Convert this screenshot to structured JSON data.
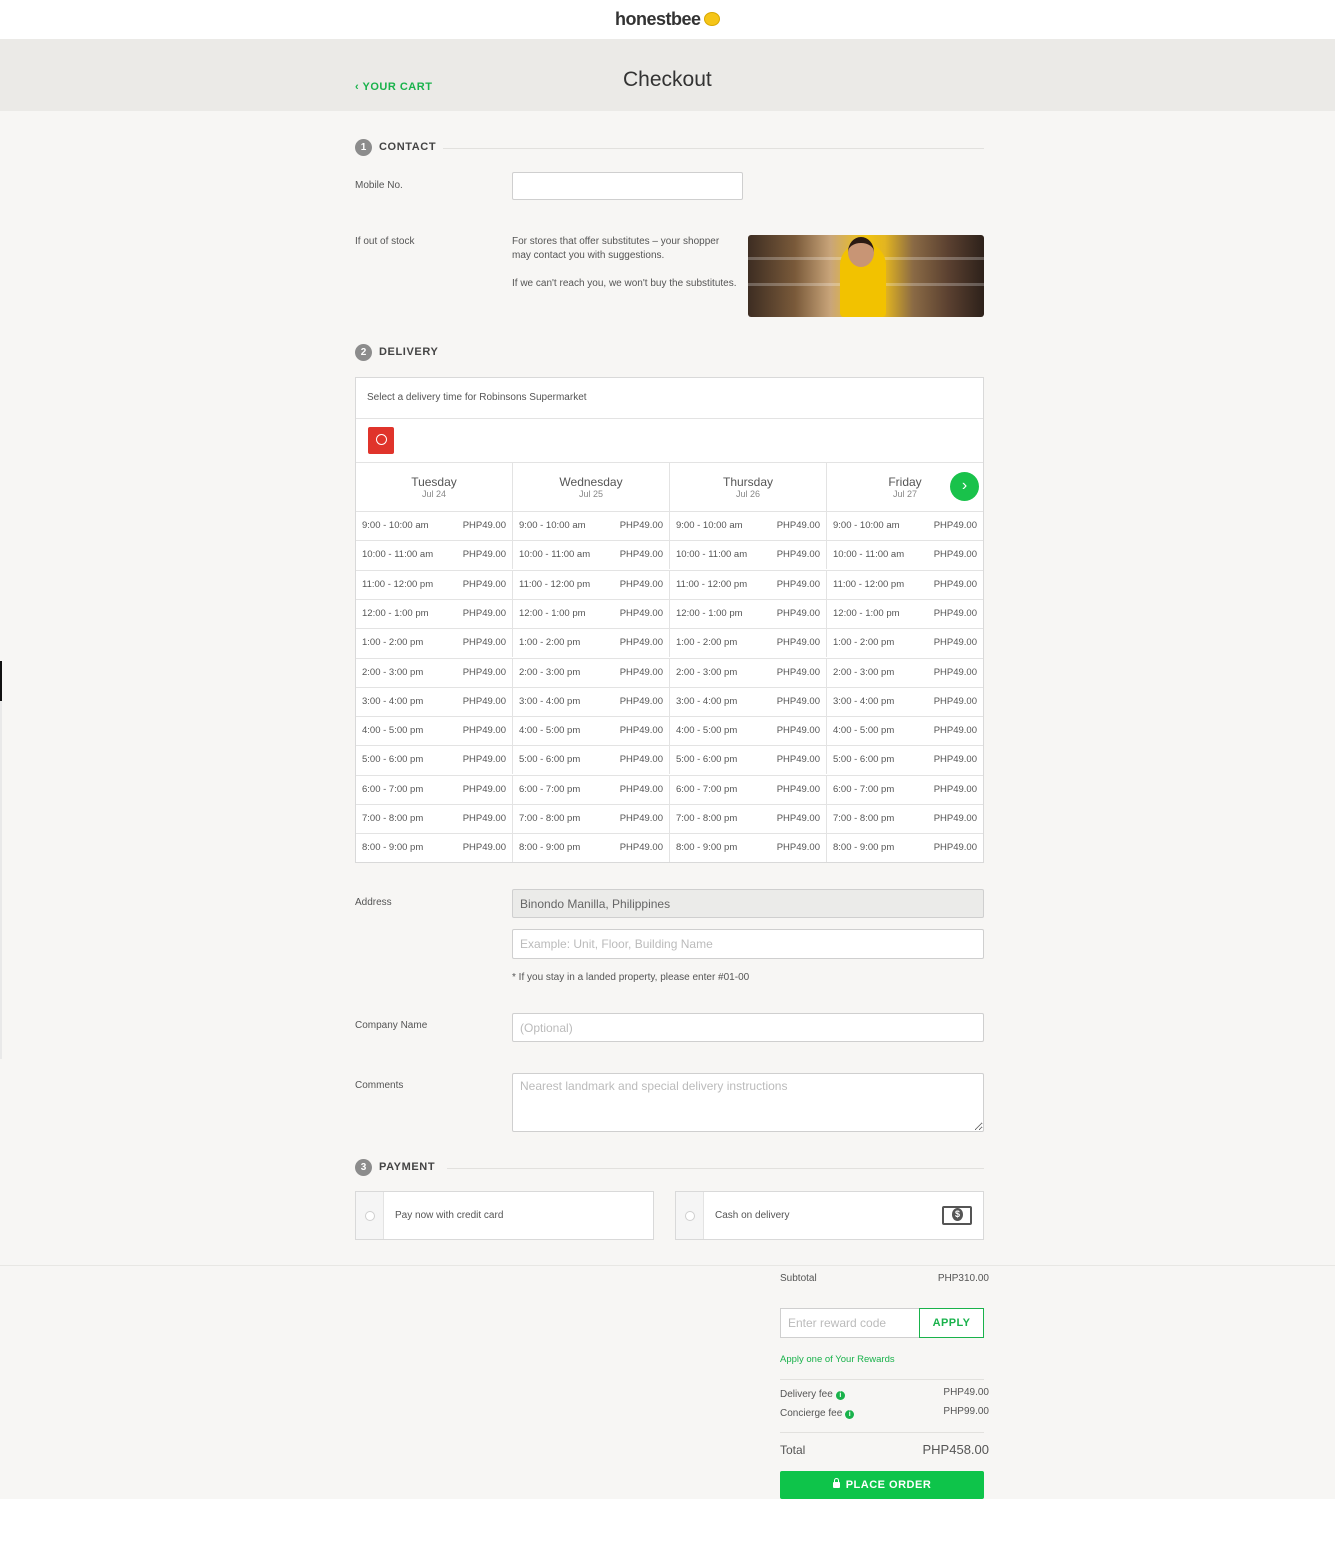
{
  "brand": {
    "name": "honestbee"
  },
  "header": {
    "back_label": "‹ YOUR CART",
    "title": "Checkout"
  },
  "contact": {
    "step": "1",
    "title": "CONTACT",
    "mobile_label": "Mobile No.",
    "mobile_value": "",
    "stock_label": "If out of stock",
    "stock_text_1": "For stores that offer substitutes – your shopper may contact you with suggestions.",
    "stock_text_2": "If we can't reach you, we won't buy the substitutes."
  },
  "delivery": {
    "step": "2",
    "title": "DELIVERY",
    "select_text": "Select a delivery time for Robinsons Supermarket",
    "days": [
      {
        "name": "Tuesday",
        "date": "Jul 24"
      },
      {
        "name": "Wednesday",
        "date": "Jul 25"
      },
      {
        "name": "Thursday",
        "date": "Jul 26"
      },
      {
        "name": "Friday",
        "date": "Jul 27"
      }
    ],
    "slots": [
      "9:00 - 10:00 am",
      "10:00 - 11:00 am",
      "11:00 - 12:00 pm",
      "12:00 - 1:00 pm",
      "1:00 - 2:00 pm",
      "2:00 - 3:00 pm",
      "3:00 - 4:00 pm",
      "4:00 - 5:00 pm",
      "5:00 - 6:00 pm",
      "6:00 - 7:00 pm",
      "7:00 - 8:00 pm",
      "8:00 - 9:00 pm"
    ],
    "slot_price": "PHP49.00"
  },
  "address": {
    "label": "Address",
    "value": "Binondo Manilla, Philippines",
    "unit_placeholder": "Example: Unit, Floor, Building Name",
    "hint": "* If you stay in a landed property, please enter #01-00",
    "company_label": "Company Name",
    "company_placeholder": "(Optional)",
    "comments_label": "Comments",
    "comments_placeholder": "Nearest landmark and special delivery instructions"
  },
  "payment": {
    "step": "3",
    "title": "PAYMENT",
    "card_label": "Pay now with credit card",
    "cash_label": "Cash on delivery"
  },
  "summary": {
    "subtotal_label": "Subtotal",
    "subtotal_value": "PHP310.00",
    "reward_placeholder": "Enter reward code",
    "apply_label": "APPLY",
    "rewards_link": "Apply one of Your Rewards",
    "delivery_fee_label": "Delivery fee",
    "delivery_fee_value": "PHP49.00",
    "concierge_fee_label": "Concierge fee",
    "concierge_fee_value": "PHP99.00",
    "total_label": "Total",
    "total_value": "PHP458.00",
    "place_order_label": "PLACE ORDER"
  },
  "colors": {
    "accent": "#19b24b",
    "button": "#0ec44a",
    "store": "#e0342b"
  }
}
